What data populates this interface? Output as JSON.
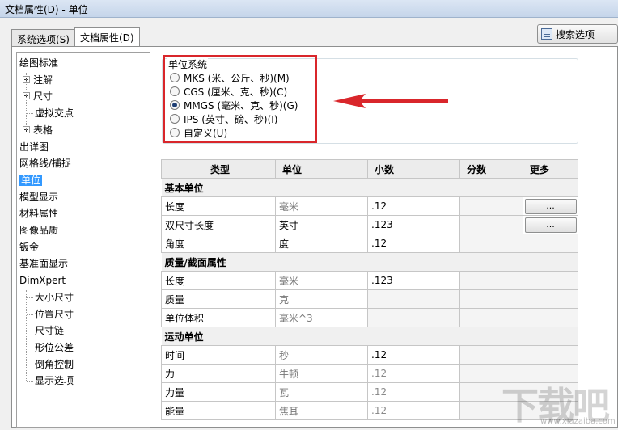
{
  "window": {
    "title": "文档属性(D) - 单位"
  },
  "tabs": [
    {
      "label": "系统选项(S)",
      "active": false
    },
    {
      "label": "文档属性(D)",
      "active": true
    }
  ],
  "search": {
    "label": "搜索选项"
  },
  "tree": {
    "items": [
      {
        "label": "绘图标准",
        "level": 0,
        "selected": false,
        "expander": false
      },
      {
        "label": "注解",
        "level": 1,
        "selected": false,
        "expander": true
      },
      {
        "label": "尺寸",
        "level": 1,
        "selected": false,
        "expander": true
      },
      {
        "label": "虚拟交点",
        "level": 1,
        "selected": false,
        "expander": false
      },
      {
        "label": "表格",
        "level": 1,
        "selected": false,
        "expander": true
      },
      {
        "label": "出详图",
        "level": 0,
        "selected": false,
        "expander": false
      },
      {
        "label": "网格线/捕捉",
        "level": 0,
        "selected": false,
        "expander": false
      },
      {
        "label": "单位",
        "level": 0,
        "selected": true,
        "expander": false
      },
      {
        "label": "模型显示",
        "level": 0,
        "selected": false,
        "expander": false
      },
      {
        "label": "材料属性",
        "level": 0,
        "selected": false,
        "expander": false
      },
      {
        "label": "图像品质",
        "level": 0,
        "selected": false,
        "expander": false
      },
      {
        "label": "钣金",
        "level": 0,
        "selected": false,
        "expander": false
      },
      {
        "label": "基准面显示",
        "level": 0,
        "selected": false,
        "expander": false
      },
      {
        "label": "DimXpert",
        "level": 0,
        "selected": false,
        "expander": false
      },
      {
        "label": "大小尺寸",
        "level": 1,
        "selected": false,
        "expander": false
      },
      {
        "label": "位置尺寸",
        "level": 1,
        "selected": false,
        "expander": false
      },
      {
        "label": "尺寸链",
        "level": 1,
        "selected": false,
        "expander": false
      },
      {
        "label": "形位公差",
        "level": 1,
        "selected": false,
        "expander": false
      },
      {
        "label": "倒角控制",
        "level": 1,
        "selected": false,
        "expander": false
      },
      {
        "label": "显示选项",
        "level": 1,
        "selected": false,
        "expander": false
      }
    ]
  },
  "unit_system": {
    "title": "单位系统",
    "options": [
      {
        "label": "MKS (米、公斤、秒)(M)",
        "checked": false
      },
      {
        "label": "CGS (厘米、克、秒)(C)",
        "checked": false
      },
      {
        "label": "MMGS (毫米、克、秒)(G)",
        "checked": true
      },
      {
        "label": "IPS (英寸、磅、秒)(I)",
        "checked": false
      },
      {
        "label": "自定义(U)",
        "checked": false
      }
    ]
  },
  "annotation": {
    "arrow_color": "#d9262b",
    "box_color": "#d9262b"
  },
  "grid": {
    "headers": [
      "类型",
      "单位",
      "小数",
      "分数",
      "更多"
    ],
    "sections": [
      {
        "title": "基本单位",
        "rows": [
          {
            "type": "长度",
            "unit": "毫米",
            "unit_enabled": false,
            "decimal": ".12",
            "decimal_enabled": true,
            "more": "..."
          },
          {
            "type": "双尺寸长度",
            "unit": "英寸",
            "unit_enabled": true,
            "decimal": ".123",
            "decimal_enabled": true,
            "more": "..."
          },
          {
            "type": "角度",
            "unit": "度",
            "unit_enabled": true,
            "decimal": ".12",
            "decimal_enabled": true,
            "more": ""
          }
        ]
      },
      {
        "title": "质量/截面属性",
        "rows": [
          {
            "type": "长度",
            "unit": "毫米",
            "unit_enabled": false,
            "decimal": ".123",
            "decimal_enabled": true,
            "more": ""
          },
          {
            "type": "质量",
            "unit": "克",
            "unit_enabled": false,
            "decimal": "",
            "decimal_enabled": false,
            "more": ""
          },
          {
            "type": "单位体积",
            "unit": "毫米^3",
            "unit_enabled": false,
            "decimal": "",
            "decimal_enabled": false,
            "more": ""
          }
        ]
      },
      {
        "title": "运动单位",
        "rows": [
          {
            "type": "时间",
            "unit": "秒",
            "unit_enabled": false,
            "decimal": ".12",
            "decimal_enabled": true,
            "more": ""
          },
          {
            "type": "力",
            "unit": "牛顿",
            "unit_enabled": false,
            "decimal": ".12",
            "decimal_enabled": false,
            "more": ""
          },
          {
            "type": "力量",
            "unit": "瓦",
            "unit_enabled": false,
            "decimal": ".12",
            "decimal_enabled": false,
            "more": ""
          },
          {
            "type": "能量",
            "unit": "焦耳",
            "unit_enabled": false,
            "decimal": ".12",
            "decimal_enabled": false,
            "more": ""
          }
        ]
      }
    ]
  },
  "watermark": {
    "text": "下载吧",
    "sub": "www.xiazaiba.com"
  }
}
